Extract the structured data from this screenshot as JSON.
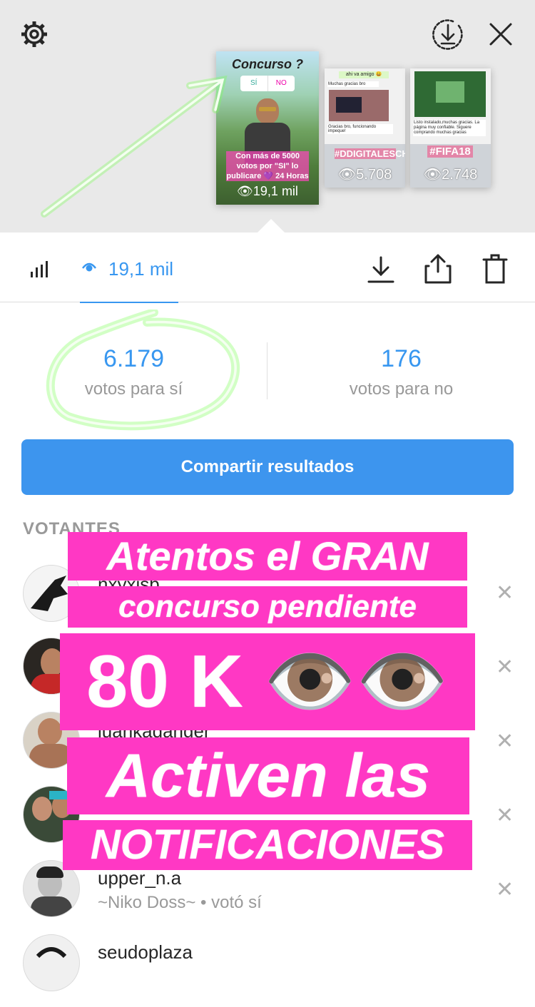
{
  "colors": {
    "accent": "#3897f0",
    "banner": "#ff38c4",
    "button": "#3d95ee"
  },
  "header": {
    "settings_icon": "gear-icon",
    "download_icon": "download-circle-icon",
    "close_icon": "close-icon"
  },
  "stories": [
    {
      "title": "Concurso ?",
      "option_yes": "SÍ",
      "option_no": "NO",
      "caption": "Con más de 5000 votos por \"SI\" lo publicare 💜 24 Horas",
      "views": "19,1 mil"
    },
    {
      "chat_top": "ahi va amigo 😀",
      "chat_msg1": "Muchas gracias bro",
      "chat_msg2": "Gracias bro, funcionando impeque!",
      "tag": "#DDIGITALESCHILE",
      "views": "5.708"
    },
    {
      "chat_msg1": "Listo instalado,muchas gracias. La página muy confiable. Siguere comprando muchas gracias",
      "tag": "#FIFA18",
      "views": "2.748"
    }
  ],
  "toolbar": {
    "views": "19,1 mil"
  },
  "results": {
    "yes": {
      "value": "6.179",
      "label": "votos para sí"
    },
    "no": {
      "value": "176",
      "label": "votos para no"
    }
  },
  "share_button": "Compartir resultados",
  "voters_title": "VOTANTES",
  "voters": [
    {
      "username": "nxyxisb",
      "sub": ""
    },
    {
      "username": "",
      "sub": ""
    },
    {
      "username": "juankadanger_",
      "sub": ""
    },
    {
      "username": "",
      "sub": ""
    },
    {
      "username": "upper_n.a",
      "sub": "~Niko Doss~ • votó sí"
    },
    {
      "username": "seudoplaza",
      "sub": ""
    }
  ],
  "overlay": {
    "line1": "Atentos el GRAN",
    "line2": "concurso pendiente",
    "line3": "80 K 👁️👁️",
    "line4": "Activen las",
    "line5": "NOTIFICACIONES"
  }
}
